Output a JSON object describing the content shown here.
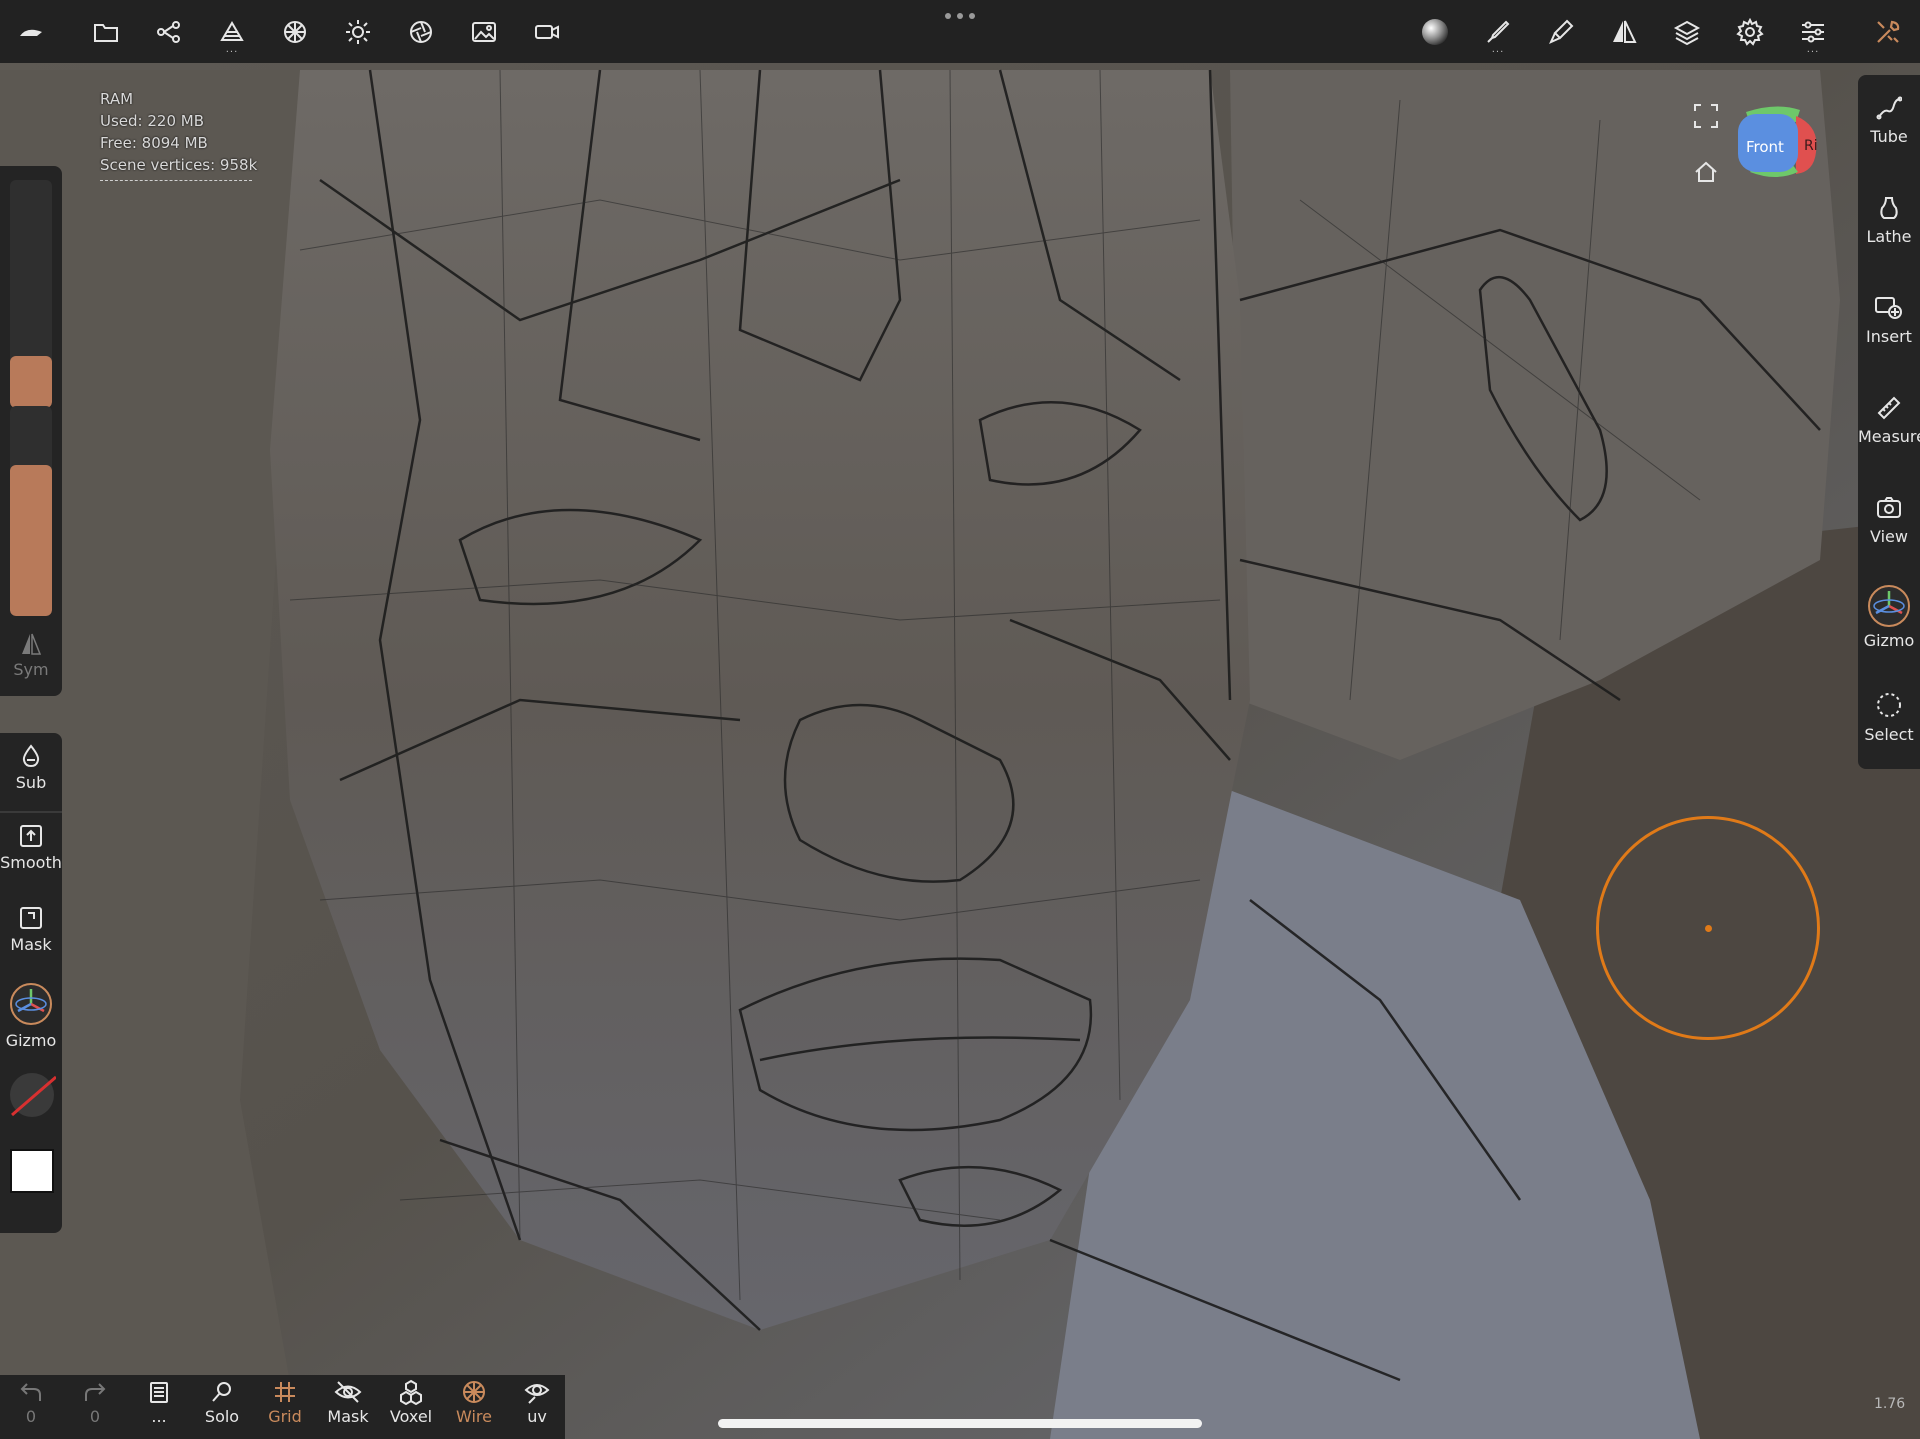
{
  "colors": {
    "accent": "#c98a5c",
    "brush": "#e07a18",
    "toolbar": "#222222",
    "panel": "#242424"
  },
  "top_toolbar": {
    "icons": [
      "nomad-logo-icon",
      "folder-icon",
      "scene-graph-icon",
      "topology-icon",
      "material-icon",
      "light-icon",
      "post-process-icon",
      "background-icon",
      "camera-icon",
      "matcap-sphere-icon",
      "brush-icon",
      "stroke-icon",
      "symmetry-icon",
      "layers-icon",
      "settings-icon",
      "sliders-icon",
      "tools-icon"
    ]
  },
  "ram": {
    "label": "RAM",
    "used": "Used: 220 MB",
    "free": "Free: 8094 MB",
    "vertices": "Scene vertices: 958k"
  },
  "left_panel": {
    "slider_radius_value": 0.23,
    "slider_intensity_value": 0.72,
    "sym_label": "Sym",
    "tools": [
      {
        "label": "Sub"
      },
      {
        "label": "Smooth"
      },
      {
        "label": "Mask"
      },
      {
        "label": "Gizmo"
      }
    ]
  },
  "right_panel": {
    "tools": [
      {
        "label": "Tube"
      },
      {
        "label": "Lathe"
      },
      {
        "label": "Insert"
      },
      {
        "label": "Measure"
      },
      {
        "label": "View"
      },
      {
        "label": "Gizmo"
      },
      {
        "label": "Select"
      }
    ]
  },
  "view_cube": {
    "front": "Front",
    "right": "Ri"
  },
  "bottom_bar": {
    "undo_count": "0",
    "redo_count": "0",
    "items": [
      {
        "label": "..."
      },
      {
        "label": "Solo"
      },
      {
        "label": "Grid"
      },
      {
        "label": "Mask"
      },
      {
        "label": "Voxel"
      },
      {
        "label": "Wire"
      },
      {
        "label": "uv"
      }
    ]
  },
  "version": "1.76"
}
